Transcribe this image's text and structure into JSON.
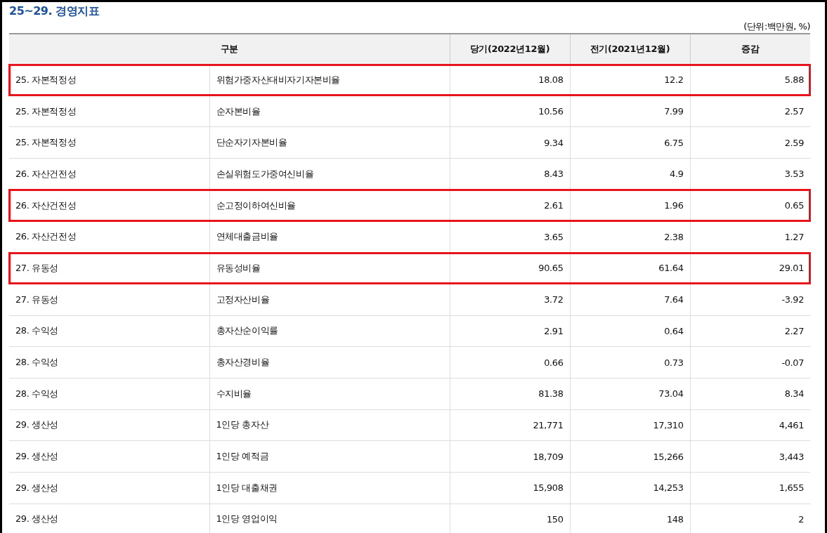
{
  "title": "25~29. 경영지표",
  "unit_note": "(단위:백만원, %)",
  "table": {
    "columns": [
      "구분",
      "당기(2022년12월)",
      "전기(2021년12월)",
      "증감"
    ],
    "rows": [
      {
        "category": "25. 자본적정성",
        "item": "위험가중자산대비자기자본비율",
        "current": "18.08",
        "previous": "12.2",
        "change": "5.88",
        "highlighted": true
      },
      {
        "category": "25. 자본적정성",
        "item": "순자본비율",
        "current": "10.56",
        "previous": "7.99",
        "change": "2.57",
        "highlighted": false
      },
      {
        "category": "25. 자본적정성",
        "item": "단순자기자본비율",
        "current": "9.34",
        "previous": "6.75",
        "change": "2.59",
        "highlighted": false
      },
      {
        "category": "26. 자산건전성",
        "item": "손실위험도가중여신비율",
        "current": "8.43",
        "previous": "4.9",
        "change": "3.53",
        "highlighted": false
      },
      {
        "category": "26. 자산건전성",
        "item": "순고정이하여신비율",
        "current": "2.61",
        "previous": "1.96",
        "change": "0.65",
        "highlighted": true
      },
      {
        "category": "26. 자산건전성",
        "item": "연체대출금비율",
        "current": "3.65",
        "previous": "2.38",
        "change": "1.27",
        "highlighted": false
      },
      {
        "category": "27. 유동성",
        "item": "유동성비율",
        "current": "90.65",
        "previous": "61.64",
        "change": "29.01",
        "highlighted": true
      },
      {
        "category": "27. 유동성",
        "item": "고정자산비율",
        "current": "3.72",
        "previous": "7.64",
        "change": "-3.92",
        "highlighted": false
      },
      {
        "category": "28. 수익성",
        "item": "총자산순이익률",
        "current": "2.91",
        "previous": "0.64",
        "change": "2.27",
        "highlighted": false
      },
      {
        "category": "28. 수익성",
        "item": "총자산경비율",
        "current": "0.66",
        "previous": "0.73",
        "change": "-0.07",
        "highlighted": false
      },
      {
        "category": "28. 수익성",
        "item": "수지비율",
        "current": "81.38",
        "previous": "73.04",
        "change": "8.34",
        "highlighted": false
      },
      {
        "category": "29. 생산성",
        "item": "1인당 총자산",
        "current": "21,771",
        "previous": "17,310",
        "change": "4,461",
        "highlighted": false
      },
      {
        "category": "29. 생산성",
        "item": "1인당 예적금",
        "current": "18,709",
        "previous": "15,266",
        "change": "3,443",
        "highlighted": false
      },
      {
        "category": "29. 생산성",
        "item": "1인당 대출채권",
        "current": "15,908",
        "previous": "14,253",
        "change": "1,655",
        "highlighted": false
      },
      {
        "category": "29. 생산성",
        "item": "1인당 영업이익",
        "current": "150",
        "previous": "148",
        "change": "2",
        "highlighted": false
      }
    ]
  }
}
